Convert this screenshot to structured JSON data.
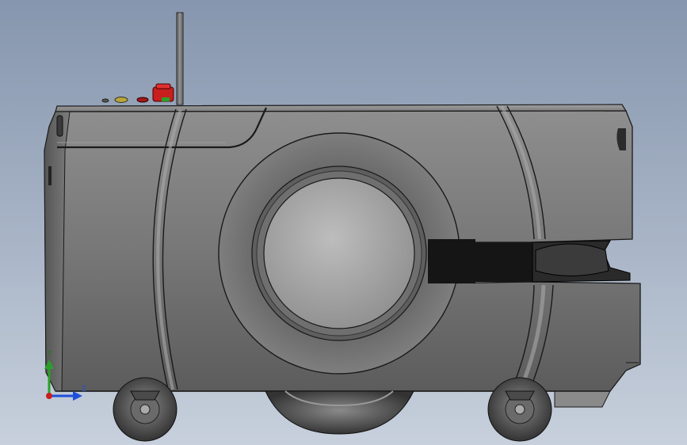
{
  "viewport": {
    "background_top": "#8696ae",
    "background_bottom": "#c7d0dc"
  },
  "model": {
    "body_color": "#7b7b7b",
    "edge_color": "#1a1a1a",
    "emergency_stop_color": "#c81e1e"
  },
  "triad": {
    "y_label": "Y",
    "z_label": "Z",
    "y_color": "#2aa02a",
    "z_color": "#1e4fd8",
    "origin_color": "#c81e1e"
  }
}
